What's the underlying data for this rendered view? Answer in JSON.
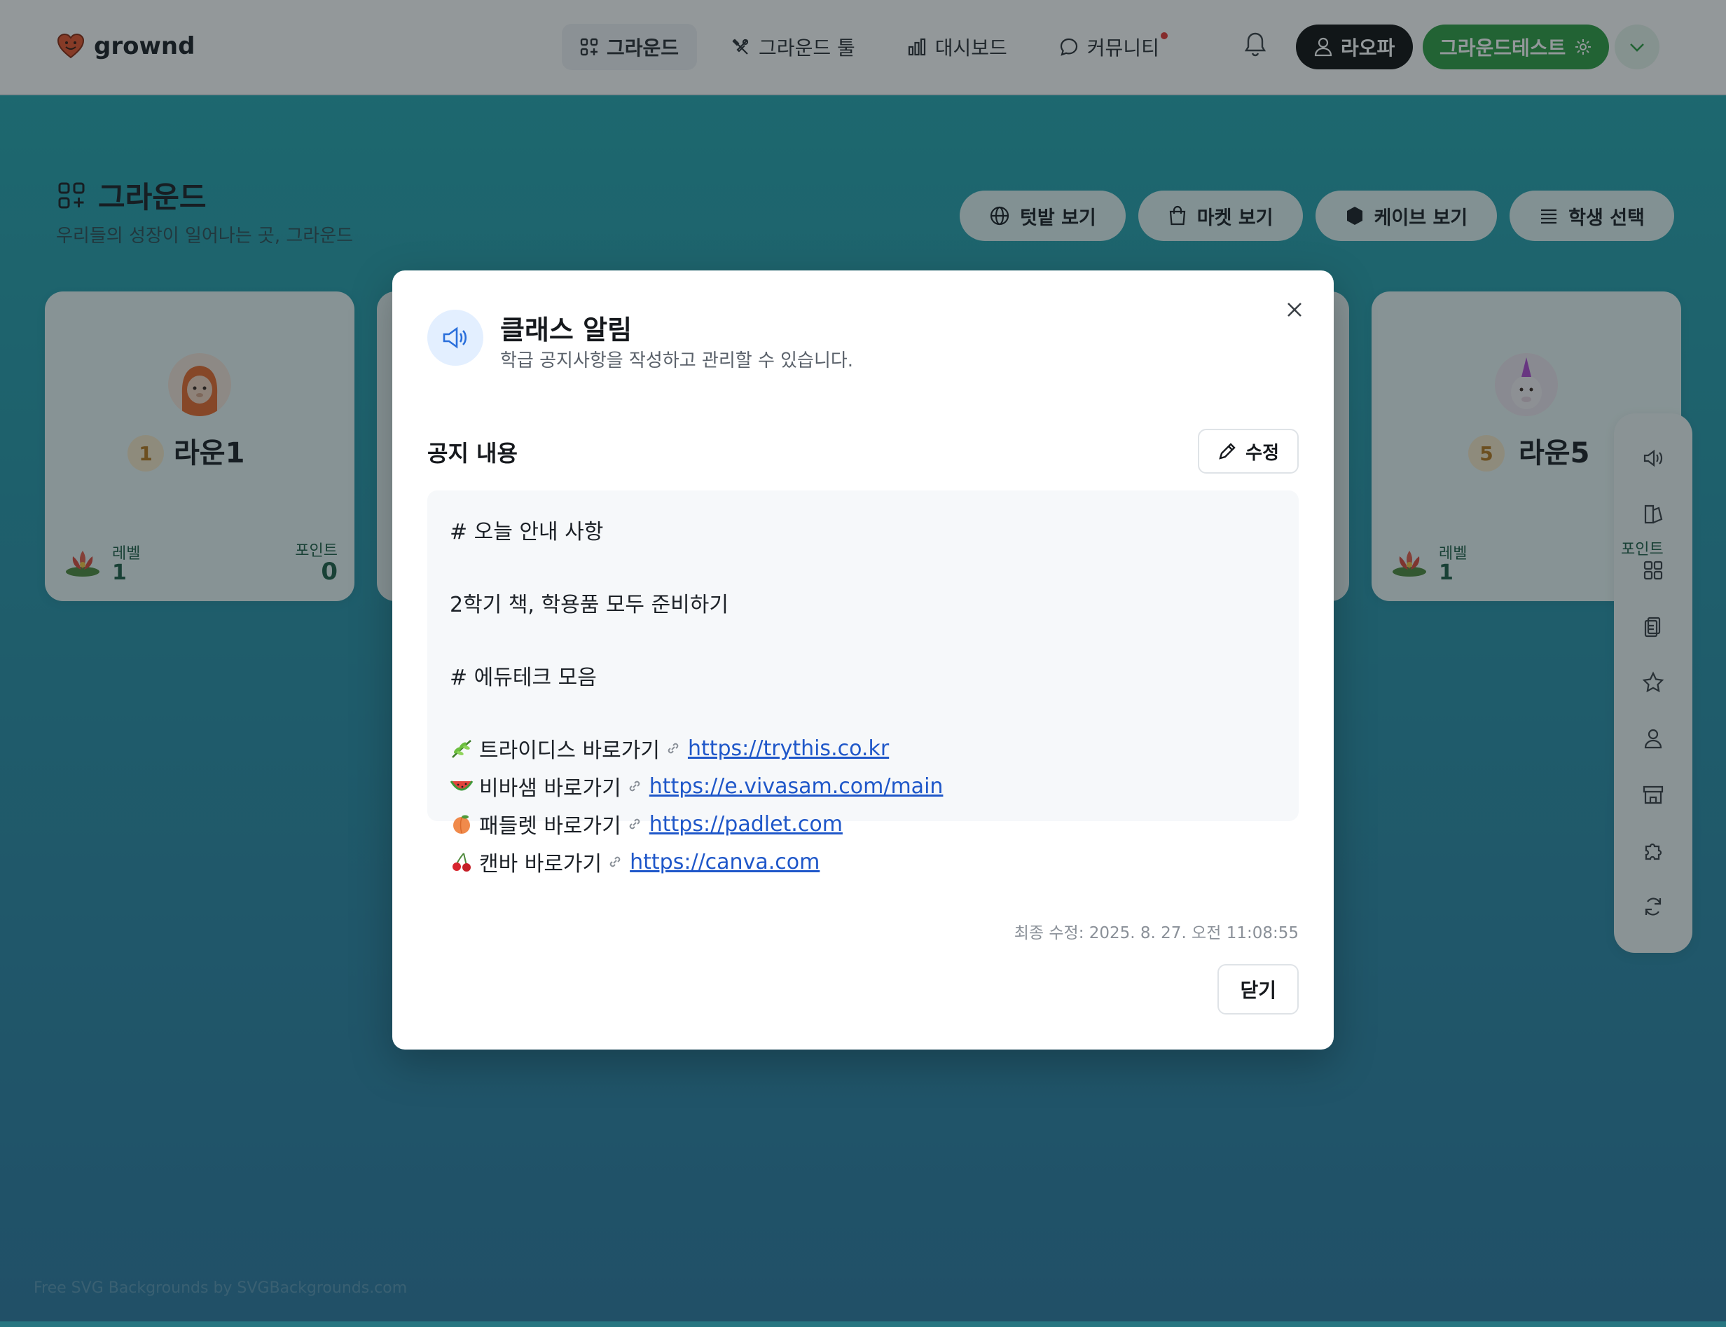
{
  "header": {
    "brand": "grownd",
    "nav": [
      {
        "label": "그라운드",
        "icon": "grid-plus-icon",
        "active": true
      },
      {
        "label": "그라운드 툴",
        "icon": "tools-icon",
        "active": false
      },
      {
        "label": "대시보드",
        "icon": "bar-chart-icon",
        "active": false
      },
      {
        "label": "커뮤니티",
        "icon": "chat-icon",
        "active": false,
        "badge": true
      }
    ],
    "user_label": "라오파",
    "class_label": "그라운드테스트"
  },
  "page": {
    "title": "그라운드",
    "subtitle": "우리들의 성장이 일어나는 곳, 그라운드",
    "actions": [
      {
        "label": "텃밭 보기",
        "icon": "globe-icon"
      },
      {
        "label": "마켓 보기",
        "icon": "shopping-bag-icon"
      },
      {
        "label": "케이브 보기",
        "icon": "hexagon-icon"
      },
      {
        "label": "학생 선택",
        "icon": "list-icon"
      }
    ]
  },
  "cards": [
    {
      "rank": "1",
      "name": "라운1",
      "level_label": "레벨",
      "level": "1",
      "points_label": "포인트",
      "points": "0"
    },
    {
      "rank": "5",
      "name": "라운5",
      "level_label": "레벨",
      "level": "1",
      "points_label": "포인트"
    }
  ],
  "modal": {
    "title": "클래스 알림",
    "description": "학급 공지사항을 작성하고 관리할 수 있습니다.",
    "section_title": "공지 내용",
    "edit_label": "수정",
    "lines": {
      "h1": "# 오늘 안내 사항",
      "p1": "2학기 책, 학용품 모두 준비하기",
      "h2": "# 에듀테크 모음"
    },
    "links": [
      {
        "emoji": "herb",
        "label": "트라이디스 바로가기",
        "url": "https://trythis.co.kr"
      },
      {
        "emoji": "watermelon",
        "label": "비바샘 바로가기",
        "url": "https://e.vivasam.com/main"
      },
      {
        "emoji": "peach",
        "label": "패들렛 바로가기",
        "url": "https://padlet.com"
      },
      {
        "emoji": "cherries",
        "label": "캔바 바로가기",
        "url": "https://canva.com"
      }
    ],
    "modified": "최종 수정: 2025. 8. 27. 오전 11:08:55",
    "close_label": "닫기"
  },
  "footer": {
    "credit": "Free SVG Backgrounds by SVGBackgrounds.com"
  },
  "colors": {
    "brand_green": "#2f9e44",
    "link_blue": "#1f57c9",
    "accent_blue": "#e3efff"
  }
}
